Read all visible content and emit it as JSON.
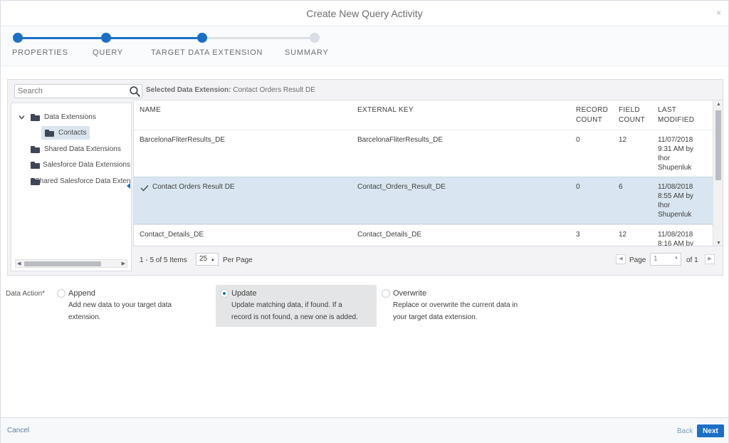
{
  "modal": {
    "title": "Create New Query Activity",
    "close_icon": "×"
  },
  "wizard": {
    "steps": [
      {
        "label": "PROPERTIES",
        "status": "done"
      },
      {
        "label": "QUERY",
        "status": "done"
      },
      {
        "label": "TARGET DATA EXTENSION",
        "status": "current"
      },
      {
        "label": "SUMMARY",
        "status": "todo"
      }
    ],
    "accent_color": "#1b6fc7"
  },
  "search": {
    "placeholder": "Search",
    "icon": "search-icon"
  },
  "selected_de": {
    "label": "Selected Data Extension:",
    "value": "Contact Orders Result DE"
  },
  "tree": {
    "items": [
      {
        "label": "Data Extensions",
        "expanded": true
      },
      {
        "label": "Contacts",
        "selected": true
      },
      {
        "label": "Shared Data Extensions"
      },
      {
        "label": "Salesforce Data Extensions"
      },
      {
        "label": "Shared Salesforce Data Extensions"
      }
    ]
  },
  "table": {
    "columns": {
      "name": "NAME",
      "external_key": "EXTERNAL KEY",
      "record_count": [
        "RECORD",
        "COUNT"
      ],
      "field_count": [
        "FIELD",
        "COUNT"
      ],
      "last_modified": [
        "LAST",
        "MODIFIED"
      ]
    },
    "rows": [
      {
        "name": "BarcelonaFliterResults_DE",
        "key": "BarcelonaFliterResults_DE",
        "records": "0",
        "fields": "12",
        "modified": [
          "11/07/2018",
          "9:31 AM by",
          "Ihor",
          "Shupenluk"
        ],
        "selected": false
      },
      {
        "name": "Contact Orders Result DE",
        "key": "Contact_Orders_Result_DE",
        "records": "0",
        "fields": "6",
        "modified": [
          "11/08/2018",
          "8:55 AM by",
          "Ihor",
          "Shupenluk"
        ],
        "selected": true
      },
      {
        "name": "Contact_Details_DE",
        "key": "Contact_Details_DE",
        "records": "3",
        "fields": "12",
        "modified": [
          "11/08/2018",
          "8:16 AM by",
          "",
          ""
        ],
        "selected": false
      }
    ]
  },
  "pager": {
    "items_label": "1 - 5 of 5 Items",
    "per_page_value": "25",
    "per_page_label": "Per Page",
    "page_label": "Page",
    "page_value": "1",
    "of_label": "of 1"
  },
  "data_action": {
    "label": "Data Action*",
    "options": [
      {
        "title": "Append",
        "desc": [
          "Add new data to your target data",
          "extension."
        ],
        "selected": false
      },
      {
        "title": "Update",
        "desc": [
          "Update matching data, if found. If a",
          "record is not found, a new one is added."
        ],
        "selected": true
      },
      {
        "title": "Overwrite",
        "desc": [
          "Replace or overwrite the current data in",
          "your target data extension."
        ],
        "selected": false
      }
    ]
  },
  "footer": {
    "cancel": "Cancel",
    "back": "Back",
    "next": "Next"
  }
}
